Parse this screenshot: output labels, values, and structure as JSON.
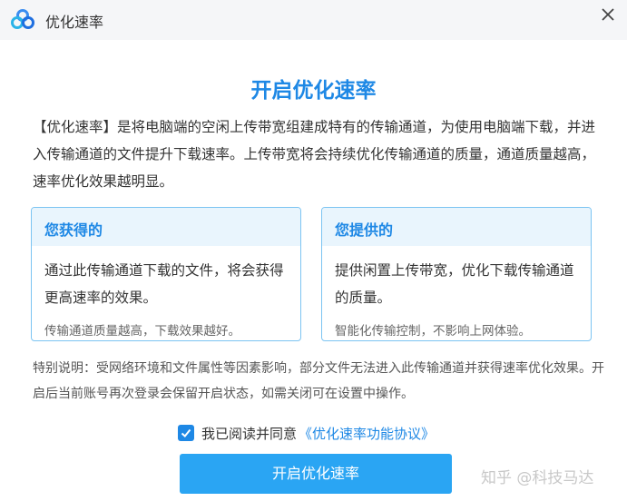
{
  "window": {
    "title": "优化速率",
    "logo_icon": "cloud-logo-icon",
    "close_icon": "close-icon"
  },
  "main": {
    "heading": "开启优化速率",
    "description": "【优化速率】是将电脑端的空闲上传带宽组建成特有的传输通道，为使用电脑端下载，并进入传输通道的文件提升下载速率。上传带宽将会持续优化传输通道的质量，通道质量越高，速率优化效果越明显。"
  },
  "cards": {
    "left": {
      "title": "您获得的",
      "body": "通过此传输通道下载的文件，将会获得更高速率的效果。",
      "note": "传输通道质量越高，下载效果越好。"
    },
    "right": {
      "title": "您提供的",
      "body": "提供闲置上传带宽，优化下载传输通道的质量。",
      "note": "智能化传输控制，不影响上网体验。"
    }
  },
  "special_note": "特别说明：受网络环境和文件属性等因素影响，部分文件无法进入此传输通道并获得速率优化效果。开启后当前账号再次登录会保留开启状态，如需关闭可在设置中操作。",
  "agreement": {
    "checked": true,
    "text": "我已阅读并同意",
    "link_text": "《优化速率功能协议》"
  },
  "actions": {
    "primary_label": "开启优化速率"
  },
  "watermark": "知乎 @科技马达",
  "colors": {
    "accent": "#1e88e5",
    "button": "#2aa5f3",
    "card_border": "#7cc4f2",
    "card_header_bg": "#e9f5fd"
  }
}
